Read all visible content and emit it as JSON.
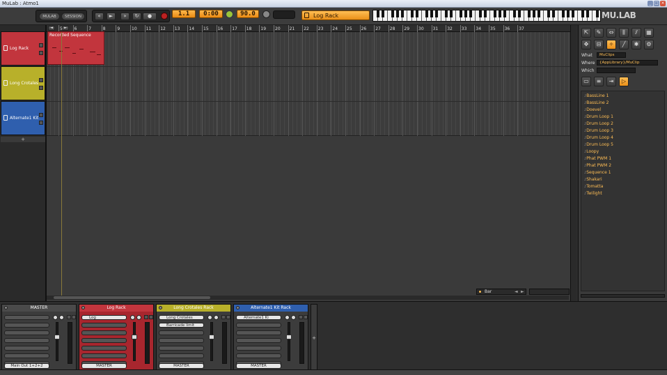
{
  "window": {
    "title": "MuLab : Atmo1"
  },
  "toolbar": {
    "mode_tabs": [
      "MULAB",
      "SESSION"
    ],
    "position": "1.1",
    "time": "0:00",
    "tempo": "90.0",
    "rack_name": "Log Rack",
    "logo": "MU.LAB",
    "icons": [
      "rewind-icon",
      "play-icon",
      "fast-forward-icon",
      "loop-icon",
      "record-icon",
      "metronome-icon",
      "link-icon"
    ]
  },
  "tracks": [
    {
      "name": "Log Rack",
      "color": "#c2353d"
    },
    {
      "name": "Long Crotales",
      "color": "#b8b02a"
    },
    {
      "name": "Alternate1 Kit",
      "color": "#2f5fae"
    }
  ],
  "add_track_label": "+",
  "ruler": {
    "marks": [
      "5",
      "6",
      "7",
      "8",
      "9",
      "10",
      "11",
      "12",
      "13",
      "14",
      "15",
      "16",
      "17",
      "18",
      "19",
      "20",
      "21",
      "22",
      "23",
      "24",
      "25",
      "26",
      "27",
      "28",
      "29",
      "30",
      "31",
      "32",
      "33",
      "34",
      "35",
      "36",
      "37"
    ]
  },
  "clip": {
    "title": "Recorded Sequence",
    "color": "#c2353d"
  },
  "snap": {
    "value": "Bar"
  },
  "browser": {
    "what_label": "What",
    "what_value": "MuClips",
    "where_label": "Where",
    "where_value": "{AppLibrary}/MuClip",
    "which_label": "Which",
    "which_value": "",
    "items": [
      "BassLine 1",
      "BassLine 2",
      "Doevel",
      "Drum Loop 1",
      "Drum Loop 2",
      "Drum Loop 3",
      "Drum Loop 4",
      "Drum Loop 5",
      "Loopy",
      "Phat PWM 1",
      "Phat PWM 2",
      "Sequence 1",
      "Shakari",
      "Tomatta",
      "Twilight"
    ]
  },
  "mixer": {
    "strips": [
      {
        "title": "MASTER",
        "color": "#4a4a4a",
        "slot1": "",
        "slot2": "",
        "output": "Main Out 1+2+2"
      },
      {
        "title": "Log Rack",
        "color": "#c2353d",
        "slot1": "Log",
        "slot2": "",
        "output": "MASTER"
      },
      {
        "title": "Long Crotales Rack",
        "color": "#b8b02a",
        "slot1": "Long Crotales",
        "slot2": "Barricade limit",
        "output": "MASTER"
      },
      {
        "title": "Alternate1 Kit Rack",
        "color": "#2f5fae",
        "slot1": "Alternate1 Ki",
        "slot2": "",
        "output": "MASTER"
      }
    ],
    "add_label": "+"
  }
}
